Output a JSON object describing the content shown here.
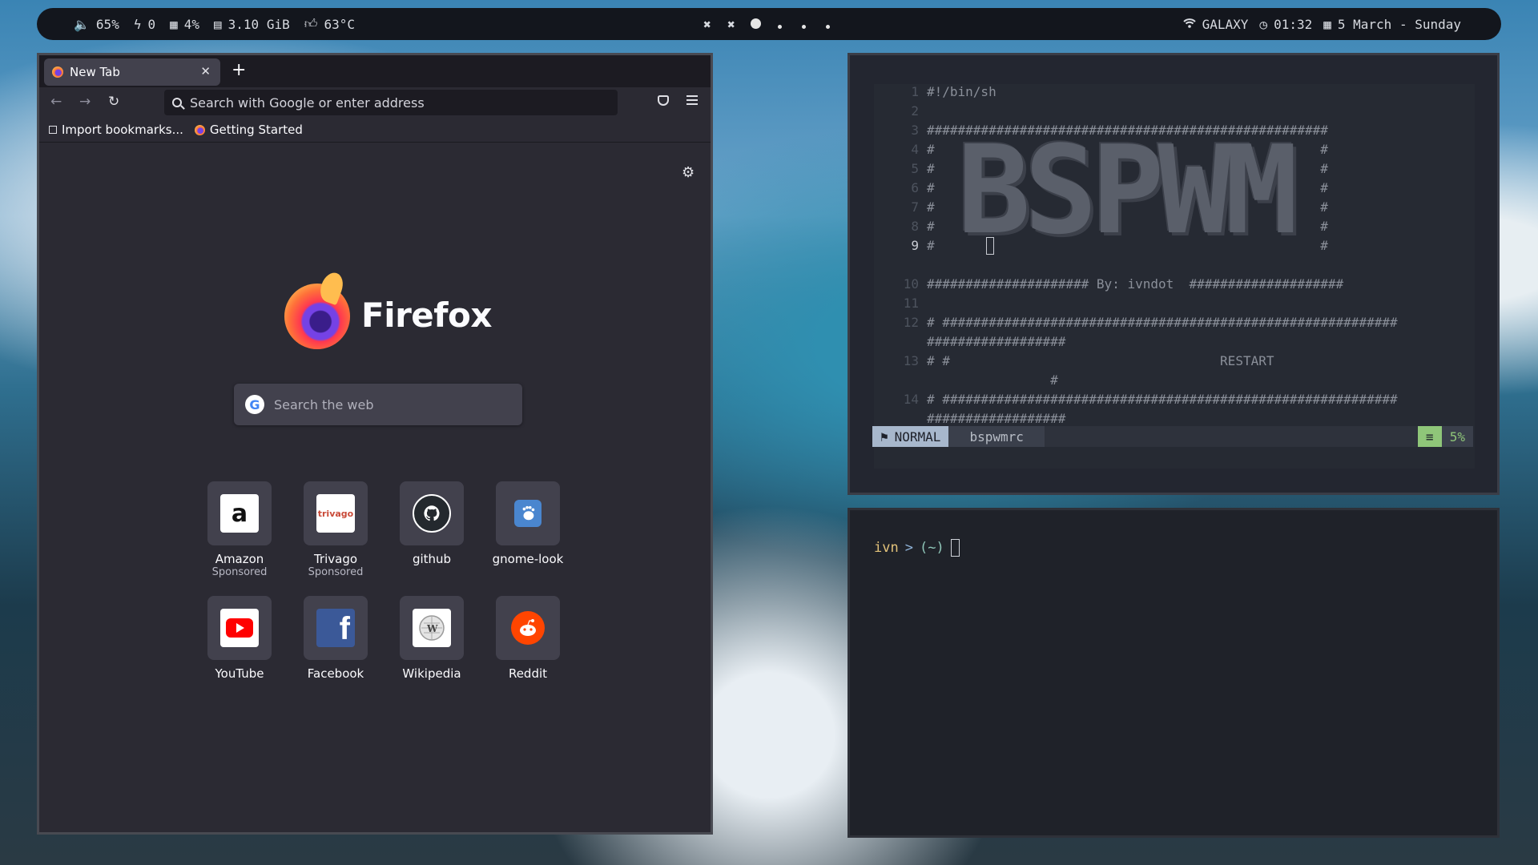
{
  "topbar": {
    "volume": "65%",
    "power": "0",
    "cpu": "4%",
    "memory": "3.10 GiB",
    "temp": "63°C",
    "wifi": "GALAXY",
    "time": "01:32",
    "date": "5 March - Sunday",
    "workspaces": [
      "close",
      "close",
      "active",
      "dot",
      "dot",
      "dot"
    ]
  },
  "firefox": {
    "tab_title": "New Tab",
    "url_placeholder": "Search with Google or enter address",
    "bookmarks": [
      "Import bookmarks...",
      "Getting Started"
    ],
    "brand": "Firefox",
    "search_placeholder": "Search the web",
    "google_letter": "G",
    "tiles": [
      {
        "name": "Amazon",
        "sponsored": "Sponsored",
        "glyph": "a",
        "bg": "#ffffff",
        "fg": "#111111"
      },
      {
        "name": "Trivago",
        "sponsored": "Sponsored",
        "glyph": "trivago",
        "bg": "#ffffff",
        "fg": "#c94a38"
      },
      {
        "name": "github",
        "sponsored": "",
        "glyph": "",
        "bg": "#24292e",
        "fg": "#ffffff"
      },
      {
        "name": "gnome-look",
        "sponsored": "",
        "glyph": "",
        "bg": "#4a86cf",
        "fg": "#ffffff"
      },
      {
        "name": "YouTube",
        "sponsored": "",
        "glyph": "▶",
        "bg": "#ffffff",
        "fg": "#ff0000"
      },
      {
        "name": "Facebook",
        "sponsored": "",
        "glyph": "f",
        "bg": "#3b5998",
        "fg": "#ffffff"
      },
      {
        "name": "Wikipedia",
        "sponsored": "",
        "glyph": "W",
        "bg": "#ffffff",
        "fg": "#444444"
      },
      {
        "name": "Reddit",
        "sponsored": "",
        "glyph": "●",
        "bg": "#ff4500",
        "fg": "#ffffff"
      }
    ]
  },
  "vim": {
    "lines": [
      {
        "n": "1",
        "text": "#!/bin/sh"
      },
      {
        "n": "2",
        "text": ""
      },
      {
        "n": "3",
        "text": "####################################################"
      },
      {
        "n": "4",
        "text": "#                                                  #"
      },
      {
        "n": "5",
        "text": "#                                                  #"
      },
      {
        "n": "6",
        "text": "#                                                  #"
      },
      {
        "n": "7",
        "text": "#                                                  #"
      },
      {
        "n": "8",
        "text": "#                                                  #"
      },
      {
        "n": "9",
        "text": "#                                                  #"
      },
      {
        "n": "10",
        "text": "##################### By: ivndot  ####################"
      },
      {
        "n": "11",
        "text": ""
      },
      {
        "n": "12",
        "text": "# ###########################################################"
      },
      {
        "n": "",
        "text": "##################"
      },
      {
        "n": "13",
        "text": "# #                                   RESTART"
      },
      {
        "n": "",
        "text": "                #"
      },
      {
        "n": "14",
        "text": "# ###########################################################"
      },
      {
        "n": "",
        "text": "##################"
      }
    ],
    "art": "BSPWM",
    "mode": "NORMAL",
    "file": "bspwmrc",
    "percent": "5%"
  },
  "terminal": {
    "user": "ivn",
    "arrow": ">",
    "dir": "(~)"
  }
}
